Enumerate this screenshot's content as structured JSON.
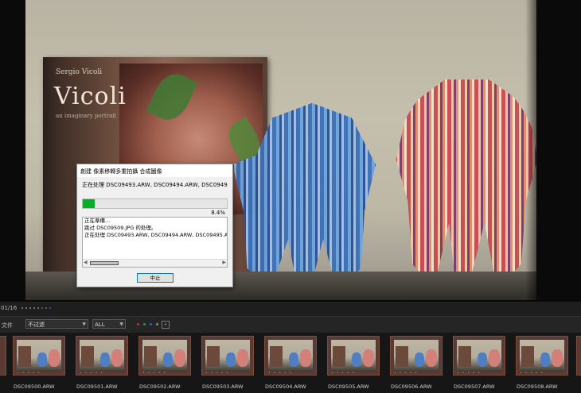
{
  "dialog": {
    "title": "創建 像素移轉多重拍攝 合成圖像",
    "files_line": "正在处理 DSC09493.ARW, DSC09494.ARW, DSC09495.ARW, ...",
    "progress_percent": 8.4,
    "progress_text": "8.4%",
    "log_lines": [
      "正在準備...",
      "跳过 DSC09509.JPG 的处理。",
      "正在处理 DSC09493.ARW, DSC09494.ARW, DSC09495.ARW, D"
    ],
    "stop_label": "中止"
  },
  "photo": {
    "book_author": "Sergio Vicoli",
    "book_title": "Vicoli",
    "book_subtitle": "an imaginary portrait"
  },
  "status": {
    "counter": "01/16"
  },
  "filterbar": {
    "label": "文件",
    "filter_value": "不过滤",
    "rating_value": "ALL",
    "dot_colors": [
      "#b53a3a",
      "#3a9a3a",
      "#3a5ab5",
      "#8a8a8a"
    ]
  },
  "filmstrip": {
    "items": [
      {
        "label": "DSC09500.ARW"
      },
      {
        "label": "DSC09501.ARW"
      },
      {
        "label": "DSC09502.ARW"
      },
      {
        "label": "DSC09503.ARW"
      },
      {
        "label": "DSC09504.ARW"
      },
      {
        "label": "DSC09505.ARW"
      },
      {
        "label": "DSC09506.ARW"
      },
      {
        "label": "DSC09507.ARW"
      },
      {
        "label": "DSC09508.ARW"
      }
    ]
  },
  "colors": {
    "progress_fill": "#06b025",
    "dialog_bg": "#f0f0f0",
    "app_bg": "#1b1b1b"
  }
}
